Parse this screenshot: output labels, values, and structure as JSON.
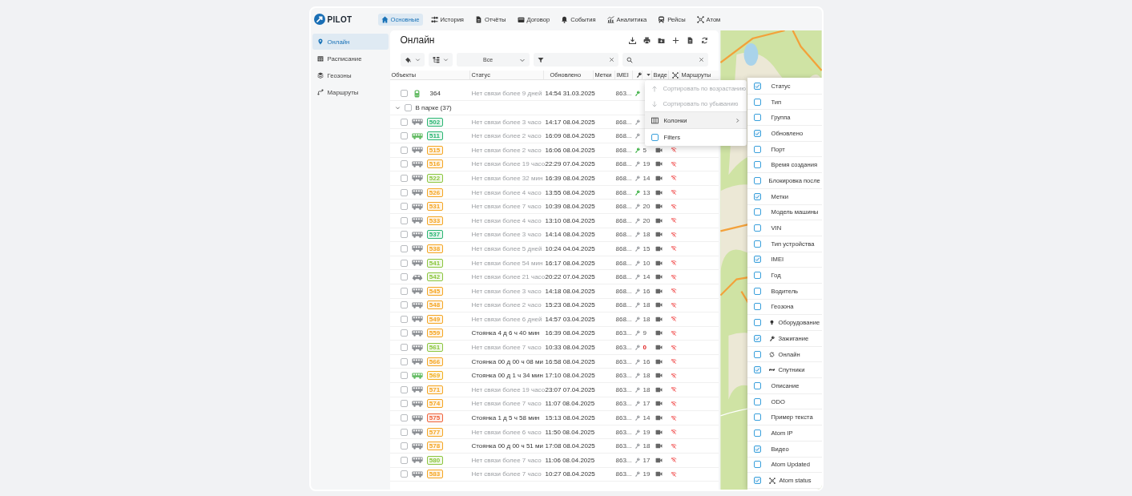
{
  "logo": {
    "text": "PILOT"
  },
  "nav": {
    "tabs": [
      {
        "label": "Основные",
        "selected": true
      },
      {
        "label": "История",
        "selected": false
      },
      {
        "label": "Отчёты",
        "selected": false
      },
      {
        "label": "Договор",
        "selected": false
      },
      {
        "label": "События",
        "selected": false
      },
      {
        "label": "Аналитика",
        "selected": false
      },
      {
        "label": "Рейсы",
        "selected": false
      },
      {
        "label": "Атом",
        "selected": false
      }
    ]
  },
  "sidebar": {
    "items": [
      {
        "label": "Онлайн",
        "selected": true
      },
      {
        "label": "Расписание",
        "selected": false
      },
      {
        "label": "Геозоны",
        "selected": false
      },
      {
        "label": "Маршруты",
        "selected": false
      }
    ]
  },
  "panel": {
    "title": "Онлайн",
    "group_select": "Все"
  },
  "table": {
    "columns": [
      "Объекты",
      "Статус",
      "Обновлено",
      "Метки",
      "IMEI",
      "Виде",
      "Маршруты"
    ],
    "group": {
      "label": "В парке (37)",
      "expanded": true,
      "checked": false
    },
    "rows": [
      {
        "number": "364",
        "kind": "tram",
        "moving": true,
        "checked": false,
        "offline": true,
        "status": "Нет связи более 9 дней",
        "updated": "14:54 31.03.2025",
        "imei": "863...",
        "ignition": true
      },
      {
        "number": "502",
        "kind": "bus",
        "moving": false,
        "color": "#2bb673",
        "checked": false,
        "offline": true,
        "status": "Нет связи более 3 часо",
        "updated": "14:17 08.04.2025",
        "imei": "868...",
        "ignition": false
      },
      {
        "number": "511",
        "kind": "bus",
        "moving": true,
        "color": "#2bb673",
        "checked": false,
        "offline": true,
        "status": "Нет связи более 2 часо",
        "updated": "16:09 08.04.2025",
        "imei": "868...",
        "ignition": false
      },
      {
        "number": "515",
        "kind": "bus",
        "moving": false,
        "color": "#f5a623",
        "checked": false,
        "offline": true,
        "status": "Нет связи более 2 часо",
        "updated": "16:06 08.04.2025",
        "imei": "868...",
        "ignition": true,
        "sats": "5",
        "no_fix": false
      },
      {
        "number": "516",
        "kind": "bus",
        "moving": false,
        "color": "#f5a623",
        "checked": false,
        "offline": true,
        "status": "Нет связи более 19 часо",
        "updated": "22:29 07.04.2025",
        "imei": "868...",
        "ignition": false,
        "sats": "19",
        "no_fix": false
      },
      {
        "number": "522",
        "kind": "bus",
        "moving": false,
        "color": "#8cc63f",
        "checked": false,
        "offline": true,
        "status": "Нет связи более 32 мин",
        "updated": "16:39 08.04.2025",
        "imei": "868...",
        "ignition": false,
        "sats": "14",
        "no_fix": false
      },
      {
        "number": "526",
        "kind": "bus",
        "moving": false,
        "color": "#f5a623",
        "checked": false,
        "offline": true,
        "status": "Нет связи более 4 часо",
        "updated": "13:55 08.04.2025",
        "imei": "868...",
        "ignition": true,
        "sats": "13",
        "no_fix": false
      },
      {
        "number": "531",
        "kind": "bus",
        "moving": false,
        "color": "#f5a623",
        "checked": false,
        "offline": true,
        "status": "Нет связи более 7 часо",
        "updated": "10:39 08.04.2025",
        "imei": "868...",
        "ignition": false,
        "sats": "20",
        "no_fix": false
      },
      {
        "number": "533",
        "kind": "bus",
        "moving": false,
        "color": "#f5a623",
        "checked": false,
        "offline": true,
        "status": "Нет связи более 4 часо",
        "updated": "13:10 08.04.2025",
        "imei": "868...",
        "ignition": false,
        "sats": "20",
        "no_fix": false
      },
      {
        "number": "537",
        "kind": "bus",
        "moving": false,
        "color": "#2bb673",
        "checked": false,
        "offline": true,
        "status": "Нет связи более 3 часо",
        "updated": "14:14 08.04.2025",
        "imei": "868...",
        "ignition": false,
        "sats": "18",
        "no_fix": false
      },
      {
        "number": "538",
        "kind": "bus",
        "moving": false,
        "color": "#f5a623",
        "checked": false,
        "offline": true,
        "status": "Нет связи более 5 дней",
        "updated": "10:24 04.04.2025",
        "imei": "868...",
        "ignition": false,
        "sats": "15",
        "no_fix": false
      },
      {
        "number": "541",
        "kind": "bus",
        "moving": false,
        "color": "#8cc63f",
        "checked": false,
        "offline": true,
        "status": "Нет связи более 54 мин",
        "updated": "16:17 08.04.2025",
        "imei": "868...",
        "ignition": false,
        "sats": "10",
        "no_fix": false
      },
      {
        "number": "542",
        "kind": "car",
        "moving": false,
        "color": "#8cc63f",
        "checked": false,
        "offline": true,
        "status": "Нет связи более 21 часо",
        "updated": "20:22 07.04.2025",
        "imei": "868...",
        "ignition": false,
        "sats": "14",
        "no_fix": false
      },
      {
        "number": "545",
        "kind": "bus",
        "moving": false,
        "color": "#f5a623",
        "checked": false,
        "offline": true,
        "status": "Нет связи более 3 часо",
        "updated": "14:18 08.04.2025",
        "imei": "868...",
        "ignition": false,
        "sats": "16",
        "no_fix": false
      },
      {
        "number": "548",
        "kind": "bus",
        "moving": false,
        "color": "#f5a623",
        "checked": false,
        "offline": true,
        "status": "Нет связи более 2 часо",
        "updated": "15:23 08.04.2025",
        "imei": "868...",
        "ignition": false,
        "sats": "18",
        "no_fix": false
      },
      {
        "number": "549",
        "kind": "bus",
        "moving": false,
        "color": "#f5a623",
        "checked": false,
        "offline": true,
        "status": "Нет связи более 6 дней",
        "updated": "14:57 03.04.2025",
        "imei": "868...",
        "ignition": false,
        "sats": "18",
        "no_fix": false
      },
      {
        "number": "559",
        "kind": "bus",
        "moving": false,
        "color": "#f5a623",
        "checked": false,
        "offline": false,
        "status": "Стоянка 4 д 6 ч 40 мин",
        "updated": "16:39 08.04.2025",
        "imei": "863...",
        "ignition": false,
        "sats": "9",
        "no_fix": false
      },
      {
        "number": "561",
        "kind": "bus",
        "moving": false,
        "color": "#8cc63f",
        "checked": false,
        "offline": true,
        "status": "Нет связи более 7 часо",
        "updated": "10:33 08.04.2025",
        "imei": "863...",
        "ignition": false,
        "sats": "0",
        "no_fix": true
      },
      {
        "number": "566",
        "kind": "bus",
        "moving": false,
        "color": "#f5a623",
        "checked": false,
        "offline": false,
        "status": "Стоянка 00 д 00 ч 08 ми",
        "updated": "16:58 08.04.2025",
        "imei": "863...",
        "ignition": false,
        "sats": "16",
        "no_fix": false
      },
      {
        "number": "569",
        "kind": "bus",
        "moving": true,
        "color": "#f2b01e",
        "checked": false,
        "offline": false,
        "status": "Стоянка 00 д 1 ч 34 мин",
        "updated": "17:10 08.04.2025",
        "imei": "863...",
        "ignition": false,
        "sats": "18",
        "no_fix": false
      },
      {
        "number": "571",
        "kind": "bus",
        "moving": false,
        "color": "#f5a623",
        "checked": false,
        "offline": true,
        "status": "Нет связи более 19 часо",
        "updated": "23:07 07.04.2025",
        "imei": "863...",
        "ignition": false,
        "sats": "18",
        "no_fix": false
      },
      {
        "number": "574",
        "kind": "bus",
        "moving": false,
        "color": "#f5a623",
        "checked": false,
        "offline": true,
        "status": "Нет связи более 7 часо",
        "updated": "11:07 08.04.2025",
        "imei": "863...",
        "ignition": false,
        "sats": "17",
        "no_fix": false
      },
      {
        "number": "575",
        "kind": "bus",
        "moving": false,
        "color": "#f0643c",
        "checked": false,
        "offline": false,
        "status": "Стоянка 1 д 5 ч 58 мин",
        "updated": "15:13 08.04.2025",
        "imei": "863...",
        "ignition": false,
        "sats": "14",
        "no_fix": false
      },
      {
        "number": "577",
        "kind": "bus",
        "moving": false,
        "color": "#f5a623",
        "checked": false,
        "offline": true,
        "status": "Нет связи более 6 часо",
        "updated": "11:50 08.04.2025",
        "imei": "863...",
        "ignition": false,
        "sats": "19",
        "no_fix": false
      },
      {
        "number": "578",
        "kind": "bus",
        "moving": false,
        "color": "#f5a623",
        "checked": false,
        "offline": false,
        "status": "Стоянка 00 д 00 ч 51 ми",
        "updated": "17:08 08.04.2025",
        "imei": "863...",
        "ignition": false,
        "sats": "18",
        "no_fix": false
      },
      {
        "number": "580",
        "kind": "bus",
        "moving": false,
        "color": "#8cc63f",
        "checked": false,
        "offline": true,
        "status": "Нет связи более 7 часо",
        "updated": "11:06 08.04.2025",
        "imei": "863...",
        "ignition": false,
        "sats": "17",
        "no_fix": false
      },
      {
        "number": "583",
        "kind": "bus",
        "moving": false,
        "color": "#f5a623",
        "checked": false,
        "offline": true,
        "status": "Нет связи более 7 часо",
        "updated": "10:27 08.04.2025",
        "imei": "863...",
        "ignition": false,
        "sats": "19",
        "no_fix": false
      }
    ]
  },
  "context_menu": {
    "items": [
      {
        "kind": "sort_asc",
        "label": "Сортировать по возрастанию",
        "disabled": true
      },
      {
        "kind": "sort_desc",
        "label": "Сортировать по убыванию",
        "disabled": true
      },
      {
        "kind": "submenu",
        "label": "Колонки",
        "expanded": true
      },
      {
        "kind": "checkbox",
        "label": "Filters",
        "checked": false
      }
    ]
  },
  "column_menu": {
    "items": [
      {
        "kind": "plain",
        "label": "Статус",
        "checked": true
      },
      {
        "kind": "plain",
        "label": "Тип",
        "checked": false
      },
      {
        "kind": "plain",
        "label": "Группа",
        "checked": false
      },
      {
        "kind": "plain",
        "label": "Обновлено",
        "checked": true
      },
      {
        "kind": "plain",
        "label": "Порт",
        "checked": false
      },
      {
        "kind": "plain",
        "label": "Время создания",
        "checked": false
      },
      {
        "kind": "plain",
        "label": "Блокировка после",
        "checked": false
      },
      {
        "kind": "plain",
        "label": "Метки",
        "checked": true
      },
      {
        "kind": "plain",
        "label": "Модель машины",
        "checked": false
      },
      {
        "kind": "plain",
        "label": "VIN",
        "checked": false
      },
      {
        "kind": "plain",
        "label": "Тип устройства",
        "checked": false
      },
      {
        "kind": "plain",
        "label": "IMEI",
        "checked": true
      },
      {
        "kind": "plain",
        "label": "Год",
        "checked": false
      },
      {
        "kind": "plain",
        "label": "Водитель",
        "checked": false
      },
      {
        "kind": "plain",
        "label": "Геозона",
        "checked": false
      },
      {
        "kind": "equipment",
        "label": "Оборудование",
        "checked": false
      },
      {
        "kind": "ignition",
        "label": "Зажигание",
        "checked": true
      },
      {
        "kind": "online",
        "label": "Онлайн",
        "checked": false
      },
      {
        "kind": "satellites",
        "label": "Спутники",
        "checked": true
      },
      {
        "kind": "plain",
        "label": "Описание",
        "checked": false
      },
      {
        "kind": "plain",
        "label": "ODO",
        "checked": false
      },
      {
        "kind": "plain",
        "label": "Пример текста",
        "checked": false
      },
      {
        "kind": "plain",
        "label": "Atom IP",
        "checked": false
      },
      {
        "kind": "plain",
        "label": "Видео",
        "checked": true
      },
      {
        "kind": "plain",
        "label": "Atom Updated",
        "checked": false
      },
      {
        "kind": "atom",
        "label": "Atom status",
        "checked": true
      }
    ]
  }
}
